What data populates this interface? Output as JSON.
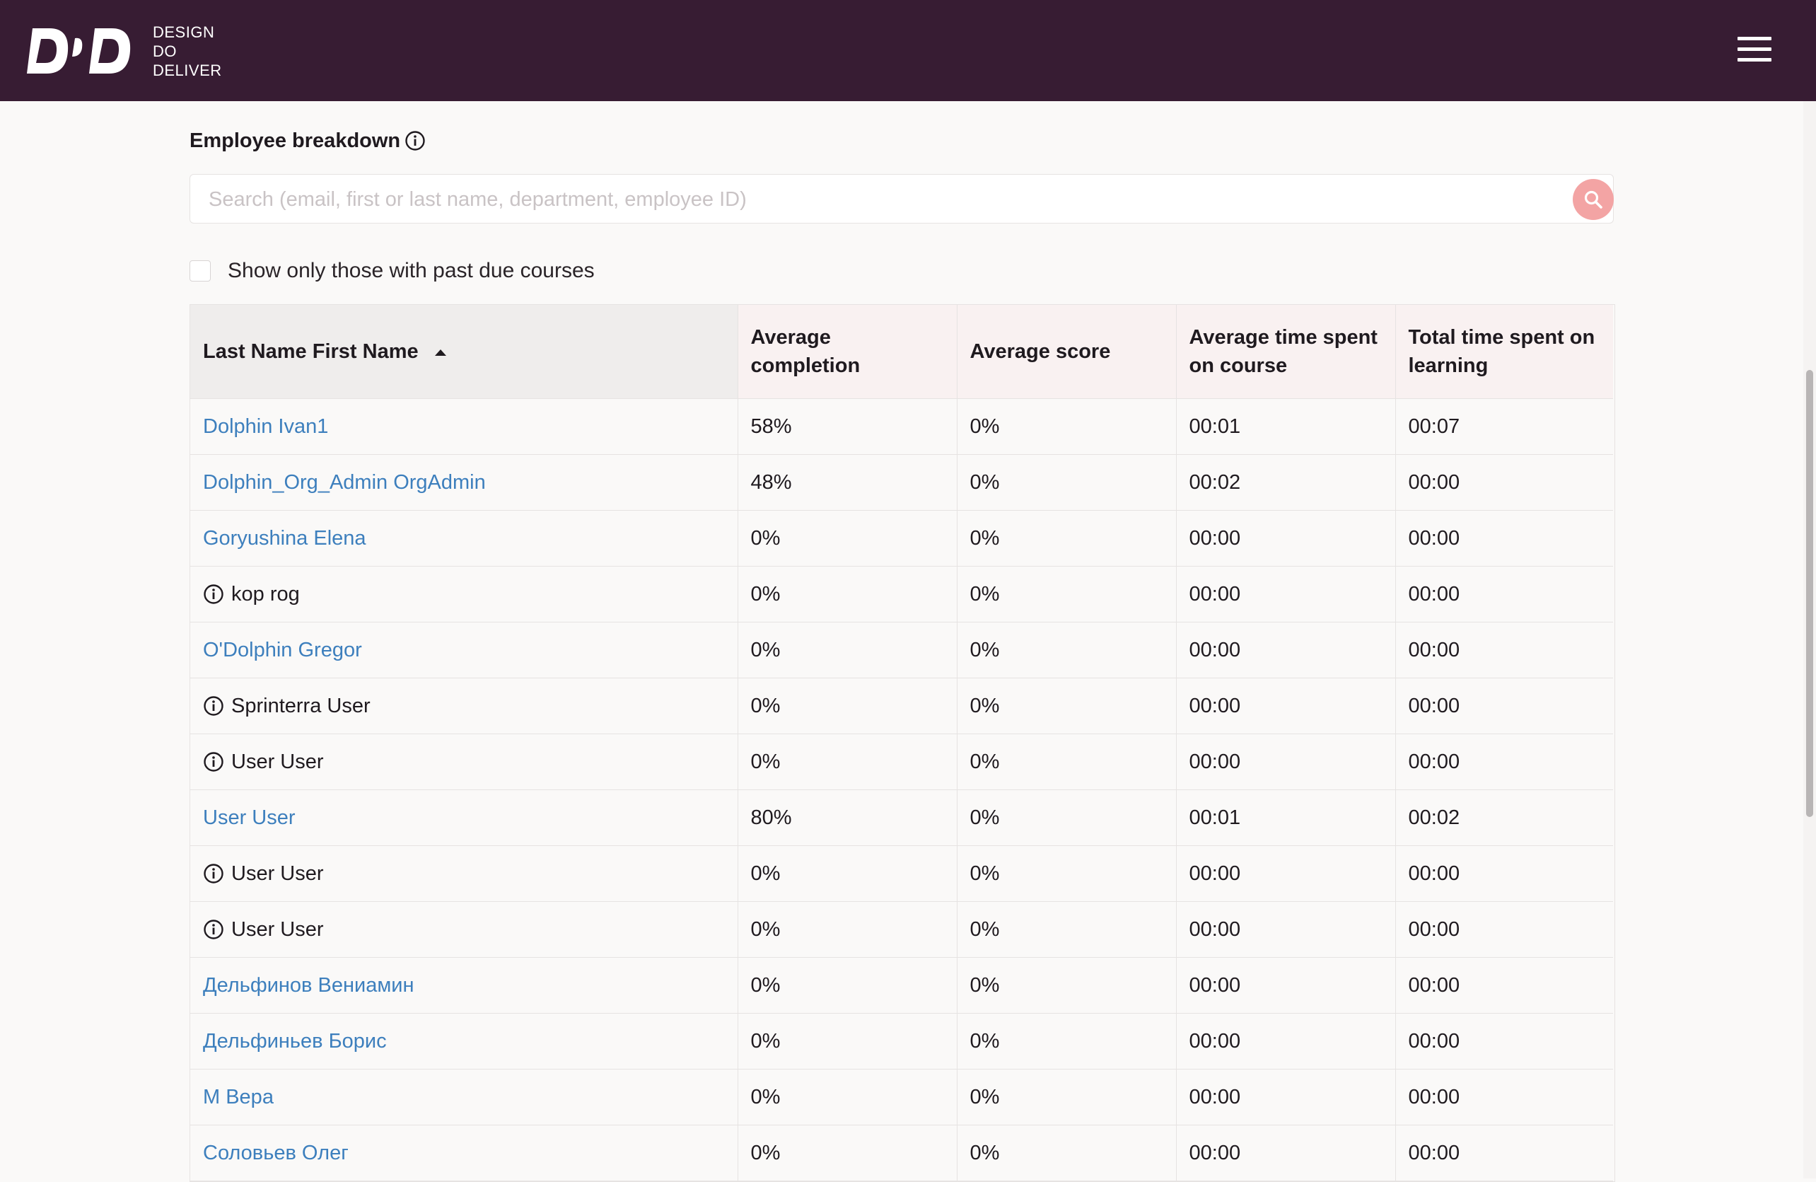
{
  "header": {
    "logo_lines": [
      "DESIGN",
      "DO",
      "DELIVER"
    ],
    "logo_mark_text": "DD",
    "menu_icon": "hamburger-menu-icon",
    "background_color": "#371c33"
  },
  "breakdown": {
    "title": "Employee breakdown",
    "search_placeholder": "Search (email, first or last name, department, employee ID)",
    "search_value": "",
    "filter_label": "Show only those with past due courses",
    "filter_checked": false
  },
  "table": {
    "columns": [
      "Last Name First Name",
      "Average completion",
      "Average score",
      "Average time spent on course",
      "Total time spent on learning"
    ],
    "sort": {
      "column": "Last Name First Name",
      "direction": "ascending"
    },
    "rows": [
      {
        "name": "Dolphin Ivan1",
        "link": true,
        "completion": "58%",
        "score": "0%",
        "avg_time": "00:01",
        "total_time": "00:07"
      },
      {
        "name": "Dolphin_Org_Admin OrgAdmin",
        "link": true,
        "completion": "48%",
        "score": "0%",
        "avg_time": "00:02",
        "total_time": "00:00"
      },
      {
        "name": "Goryushina Elena",
        "link": true,
        "completion": "0%",
        "score": "0%",
        "avg_time": "00:00",
        "total_time": "00:00"
      },
      {
        "name": "kop rog",
        "link": false,
        "completion": "0%",
        "score": "0%",
        "avg_time": "00:00",
        "total_time": "00:00"
      },
      {
        "name": "O'Dolphin Gregor",
        "link": true,
        "completion": "0%",
        "score": "0%",
        "avg_time": "00:00",
        "total_time": "00:00"
      },
      {
        "name": "Sprinterra User",
        "link": false,
        "completion": "0%",
        "score": "0%",
        "avg_time": "00:00",
        "total_time": "00:00"
      },
      {
        "name": "User User",
        "link": false,
        "completion": "0%",
        "score": "0%",
        "avg_time": "00:00",
        "total_time": "00:00"
      },
      {
        "name": "User User",
        "link": true,
        "completion": "80%",
        "score": "0%",
        "avg_time": "00:01",
        "total_time": "00:02"
      },
      {
        "name": "User User",
        "link": false,
        "completion": "0%",
        "score": "0%",
        "avg_time": "00:00",
        "total_time": "00:00"
      },
      {
        "name": "User User",
        "link": false,
        "completion": "0%",
        "score": "0%",
        "avg_time": "00:00",
        "total_time": "00:00"
      },
      {
        "name": "Дельфинов Вениамин",
        "link": true,
        "completion": "0%",
        "score": "0%",
        "avg_time": "00:00",
        "total_time": "00:00"
      },
      {
        "name": "Дельфиньев Борис",
        "link": true,
        "completion": "0%",
        "score": "0%",
        "avg_time": "00:00",
        "total_time": "00:00"
      },
      {
        "name": "М Вера",
        "link": true,
        "completion": "0%",
        "score": "0%",
        "avg_time": "00:00",
        "total_time": "00:00"
      },
      {
        "name": "Соловьев Олег",
        "link": true,
        "completion": "0%",
        "score": "0%",
        "avg_time": "00:00",
        "total_time": "00:00"
      }
    ]
  },
  "colors": {
    "link": "#3d7fbd",
    "search_button": "#f3a4a4",
    "header_cell": "#f9f1f1",
    "sorted_header_cell": "#efedec"
  }
}
